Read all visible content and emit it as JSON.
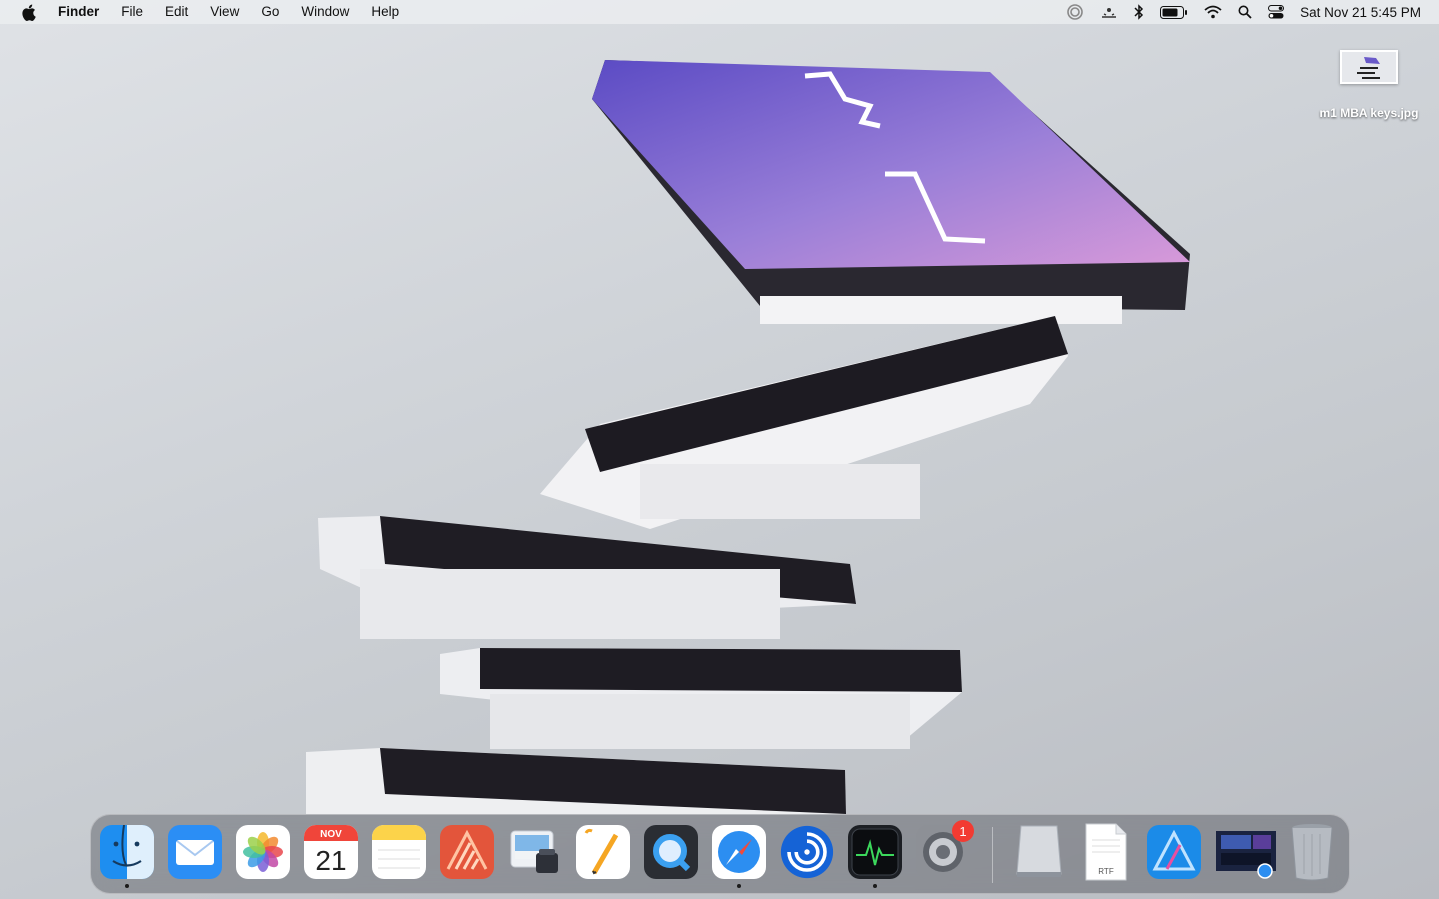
{
  "menubar": {
    "app_name": "Finder",
    "items": [
      "File",
      "Edit",
      "View",
      "Go",
      "Window",
      "Help"
    ],
    "clock": "Sat Nov 21  5:45 PM",
    "status_icons": [
      "istat-icon",
      "weather-icon",
      "bluetooth-icon",
      "battery-icon",
      "wifi-icon",
      "spotlight-icon",
      "control-center-icon"
    ]
  },
  "desktop": {
    "file_name": "m1 MBA keys.jpg"
  },
  "dock": {
    "apps": [
      {
        "name": "Finder",
        "icon": "finder-icon",
        "running": true
      },
      {
        "name": "Mail",
        "icon": "mail-icon",
        "running": false
      },
      {
        "name": "Photos",
        "icon": "photos-icon",
        "running": false
      },
      {
        "name": "Calendar",
        "icon": "calendar-icon",
        "running": false,
        "month": "NOV",
        "day": "21"
      },
      {
        "name": "Notes",
        "icon": "notes-icon",
        "running": false
      },
      {
        "name": "Affinity Publisher",
        "icon": "affinity-publisher-icon",
        "running": false
      },
      {
        "name": "Preview",
        "icon": "preview-icon",
        "running": false
      },
      {
        "name": "Pages",
        "icon": "pages-icon",
        "running": false
      },
      {
        "name": "QuickTime Player",
        "icon": "quicktime-icon",
        "running": false
      },
      {
        "name": "Safari",
        "icon": "safari-icon",
        "running": true
      },
      {
        "name": "iStat Menus",
        "icon": "istat-icon",
        "running": false
      },
      {
        "name": "Activity Monitor",
        "icon": "activity-monitor-icon",
        "running": true
      },
      {
        "name": "System Preferences",
        "icon": "system-preferences-icon",
        "running": false,
        "badge": "1"
      }
    ],
    "others": [
      {
        "name": "Drive",
        "icon": "drive-icon"
      },
      {
        "name": "RTF Document",
        "icon": "rtf-document-icon",
        "label": "RTF"
      },
      {
        "name": "Affinity Designer",
        "icon": "affinity-designer-icon"
      },
      {
        "name": "Screenshot",
        "icon": "screenshot-stack-icon"
      },
      {
        "name": "Trash",
        "icon": "trash-icon"
      }
    ]
  }
}
